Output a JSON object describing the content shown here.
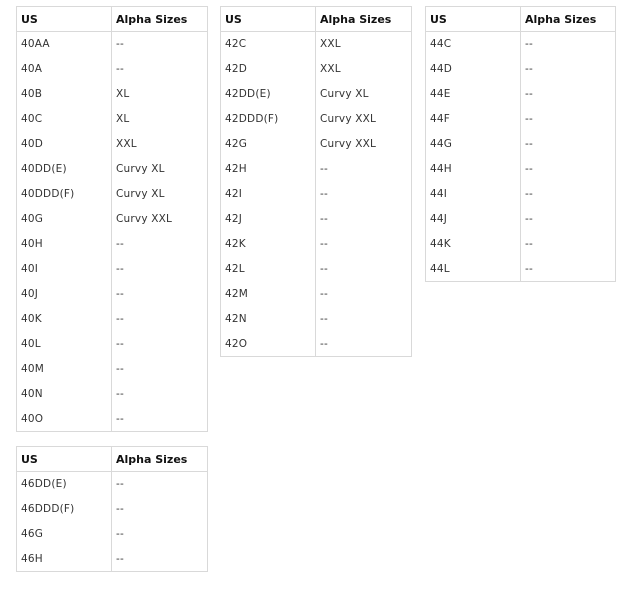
{
  "tables": [
    {
      "headers": {
        "us": "US",
        "alpha": "Alpha Sizes"
      },
      "rows": [
        {
          "us": "40AA",
          "alpha": "--"
        },
        {
          "us": "40A",
          "alpha": "--"
        },
        {
          "us": "40B",
          "alpha": "XL"
        },
        {
          "us": "40C",
          "alpha": "XL"
        },
        {
          "us": "40D",
          "alpha": "XXL"
        },
        {
          "us": "40DD(E)",
          "alpha": "Curvy XL"
        },
        {
          "us": "40DDD(F)",
          "alpha": "Curvy XL"
        },
        {
          "us": "40G",
          "alpha": "Curvy XXL"
        },
        {
          "us": "40H",
          "alpha": "--"
        },
        {
          "us": "40I",
          "alpha": "--"
        },
        {
          "us": "40J",
          "alpha": "--"
        },
        {
          "us": "40K",
          "alpha": "--"
        },
        {
          "us": "40L",
          "alpha": "--"
        },
        {
          "us": "40M",
          "alpha": "--"
        },
        {
          "us": "40N",
          "alpha": "--"
        },
        {
          "us": "40O",
          "alpha": "--"
        }
      ]
    },
    {
      "headers": {
        "us": "US",
        "alpha": "Alpha Sizes"
      },
      "rows": [
        {
          "us": "42C",
          "alpha": "XXL"
        },
        {
          "us": "42D",
          "alpha": "XXL"
        },
        {
          "us": "42DD(E)",
          "alpha": "Curvy XL"
        },
        {
          "us": "42DDD(F)",
          "alpha": "Curvy XXL"
        },
        {
          "us": "42G",
          "alpha": "Curvy XXL"
        },
        {
          "us": "42H",
          "alpha": "--"
        },
        {
          "us": "42I",
          "alpha": "--"
        },
        {
          "us": "42J",
          "alpha": "--"
        },
        {
          "us": "42K",
          "alpha": "--"
        },
        {
          "us": "42L",
          "alpha": "--"
        },
        {
          "us": "42M",
          "alpha": "--"
        },
        {
          "us": "42N",
          "alpha": "--"
        },
        {
          "us": "42O",
          "alpha": "--"
        }
      ]
    },
    {
      "headers": {
        "us": "US",
        "alpha": "Alpha Sizes"
      },
      "rows": [
        {
          "us": "44C",
          "alpha": "--"
        },
        {
          "us": "44D",
          "alpha": "--"
        },
        {
          "us": "44E",
          "alpha": "--"
        },
        {
          "us": "44F",
          "alpha": "--"
        },
        {
          "us": "44G",
          "alpha": "--"
        },
        {
          "us": "44H",
          "alpha": "--"
        },
        {
          "us": "44I",
          "alpha": "--"
        },
        {
          "us": "44J",
          "alpha": "--"
        },
        {
          "us": "44K",
          "alpha": "--"
        },
        {
          "us": "44L",
          "alpha": "--"
        }
      ]
    },
    {
      "headers": {
        "us": "US",
        "alpha": "Alpha Sizes"
      },
      "rows": [
        {
          "us": "46DD(E)",
          "alpha": "--"
        },
        {
          "us": "46DDD(F)",
          "alpha": "--"
        },
        {
          "us": "46G",
          "alpha": "--"
        },
        {
          "us": "46H",
          "alpha": "--"
        }
      ]
    }
  ],
  "colors": {
    "border": "#d9d9d9",
    "header_text": "#111111",
    "cell_text": "#333333",
    "background": "#ffffff"
  }
}
